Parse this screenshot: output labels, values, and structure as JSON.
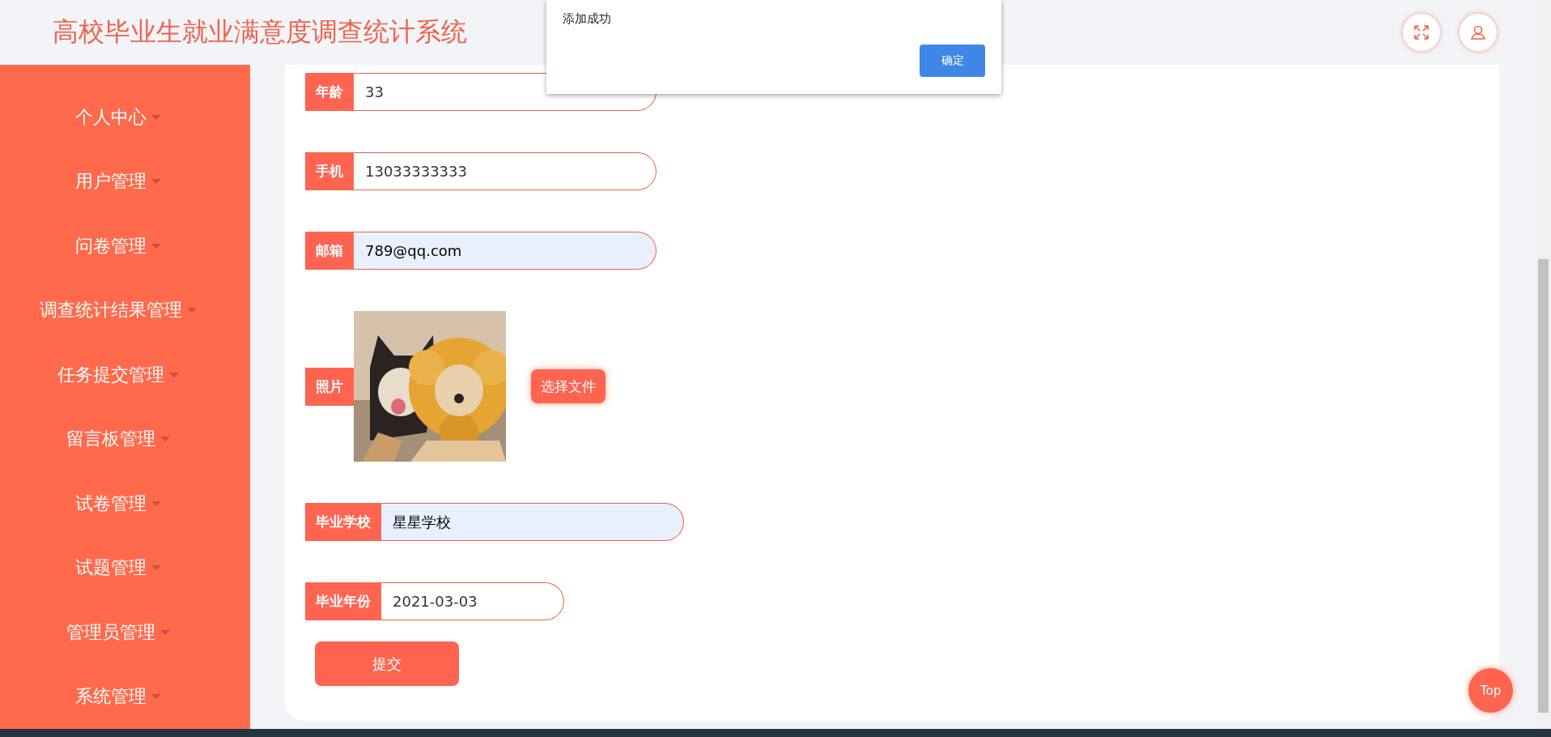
{
  "header": {
    "title": "高校毕业生就业满意度调查统计系统"
  },
  "sidebar": {
    "items": [
      {
        "label": "个人中心"
      },
      {
        "label": "用户管理"
      },
      {
        "label": "问卷管理"
      },
      {
        "label": "调查统计结果管理"
      },
      {
        "label": "任务提交管理"
      },
      {
        "label": "留言板管理"
      },
      {
        "label": "试卷管理"
      },
      {
        "label": "试题管理"
      },
      {
        "label": "管理员管理"
      },
      {
        "label": "系统管理"
      }
    ]
  },
  "form": {
    "fields": [
      {
        "kind": "text",
        "label": "年龄",
        "value": "33",
        "autofilled": false
      },
      {
        "kind": "text",
        "label": "手机",
        "value": "13033333333",
        "autofilled": false
      },
      {
        "kind": "text",
        "label": "邮箱",
        "value": "789@qq.com",
        "autofilled": true
      },
      {
        "label": "照片",
        "button": "选择文件"
      },
      {
        "kind": "text",
        "label": "毕业学校",
        "value": "星星学校",
        "autofilled": true
      },
      {
        "kind": "date",
        "label": "毕业年份",
        "value": "2021-03-03",
        "autofilled": false
      }
    ],
    "submit": "提交"
  },
  "dialog": {
    "message": "添加成功",
    "button": "确定"
  },
  "back_to_top": "Top"
}
